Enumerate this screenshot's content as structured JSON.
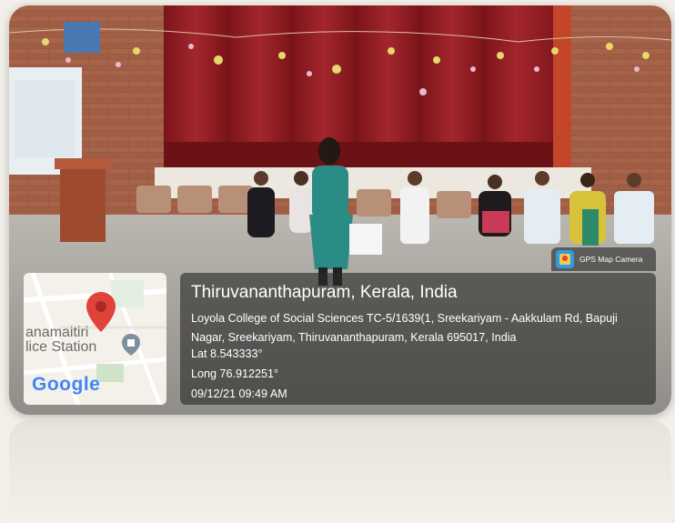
{
  "location": {
    "city": "Thiruvananthapuram, Kerala, India",
    "address": "Loyola College of Social Sciences TC-5/1639(1, Sreekariyam - Aakkulam Rd, Bapuji Nagar, Sreekariyam, Thiruvananthapuram, Kerala 695017, India",
    "lat": "Lat 8.543333°",
    "long": "Long 76.912251°",
    "timestamp": "09/12/21 09:49 AM"
  },
  "badge": {
    "label": "GPS Map Camera",
    "icon": "gps-map-camera-icon"
  },
  "map": {
    "label_line1": "anamaitiri",
    "label_line2": "lice Station",
    "brand": "Google",
    "pin_icon": "map-pin-icon",
    "poi_icon": "police-station-icon"
  },
  "colors": {
    "curtain": "#8e1b22",
    "brick": "#9a5a43",
    "dress": "#2b8c85",
    "pin": "#e0433a"
  }
}
